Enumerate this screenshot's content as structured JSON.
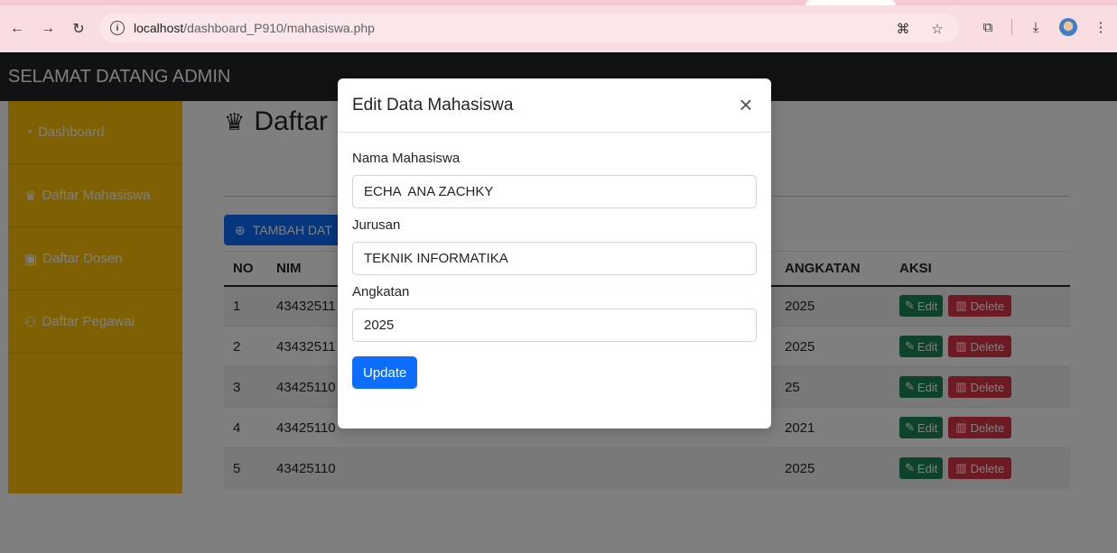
{
  "browser": {
    "url_host": "localhost",
    "url_path": "/dashboard_P910/mahasiswa.php"
  },
  "page": {
    "brand": "SELAMAT DATANG ADMIN",
    "title": "Daftar",
    "add_button": "TAMBAH DAT",
    "sidebar": [
      {
        "label": "Dashboard",
        "icon": "dashboard-icon"
      },
      {
        "label": "Daftar Mahasiswa",
        "icon": "graduate-icon"
      },
      {
        "label": "Daftar Dosen",
        "icon": "teacher-icon"
      },
      {
        "label": "Daftar Pegawai",
        "icon": "users-icon"
      }
    ],
    "table": {
      "headers": [
        "NO",
        "NIM",
        "ANGKATAN",
        "AKSI"
      ],
      "rows": [
        {
          "no": "1",
          "nim": "43432511",
          "angkatan": "2025"
        },
        {
          "no": "2",
          "nim": "43432511",
          "angkatan": "2025"
        },
        {
          "no": "3",
          "nim": "43425110",
          "angkatan": "25"
        },
        {
          "no": "4",
          "nim": "43425110",
          "angkatan": "2021"
        },
        {
          "no": "5",
          "nim": "43425110",
          "angkatan": "2025"
        }
      ],
      "edit_label": "Edit",
      "delete_label": "Delete"
    }
  },
  "modal": {
    "title": "Edit Data Mahasiswa",
    "fields": [
      {
        "label": "Nama Mahasiswa",
        "value": "ECHA  ANA ZACHKY"
      },
      {
        "label": "Jurusan",
        "value": "TEKNIK INFORMATIKA"
      },
      {
        "label": "Angkatan",
        "value": "2025"
      }
    ],
    "submit": "Update"
  },
  "colors": {
    "sidebar": "#ffc107",
    "topbar": "#212529",
    "primary": "#0d6efd",
    "success": "#198754",
    "danger": "#dc3545",
    "browser_toolbar": "#f8dde1"
  }
}
